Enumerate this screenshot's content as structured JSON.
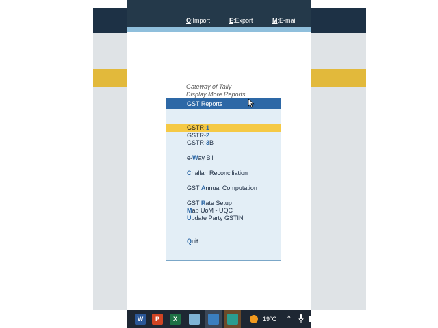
{
  "toolbar": {
    "import": {
      "key": "O",
      "label": "Import"
    },
    "export": {
      "key": "E",
      "label": "Export"
    },
    "email": {
      "key": "M",
      "label": "E-mail"
    }
  },
  "breadcrumb": {
    "line1": "Gateway of Tally",
    "line2": "Display More Reports"
  },
  "menu": {
    "title": "GST Reports",
    "items": [
      {
        "hotkey": "",
        "pre": "GSTR-",
        "key": "1",
        "post": "",
        "active": true
      },
      {
        "hotkey": "",
        "pre": "GSTR-",
        "key": "2",
        "post": "",
        "active": false
      },
      {
        "hotkey": "",
        "pre": "GSTR-",
        "key": "3",
        "post": "B",
        "active": false
      },
      {
        "hotkey": "",
        "pre": "e-",
        "key": "W",
        "post": "ay Bill",
        "active": false
      },
      {
        "hotkey": "",
        "pre": "",
        "key": "C",
        "post": "hallan Reconciliation",
        "active": false
      },
      {
        "hotkey": "",
        "pre": "GST ",
        "key": "A",
        "post": "nnual Computation",
        "active": false
      },
      {
        "hotkey": "",
        "pre": "GST ",
        "key": "R",
        "post": "ate Setup",
        "active": false
      },
      {
        "hotkey": "",
        "pre": "",
        "key": "M",
        "post": "ap UoM - UQC",
        "active": false
      },
      {
        "hotkey": "",
        "pre": "",
        "key": "U",
        "post": "pdate Party GSTIN",
        "active": false
      },
      {
        "hotkey": "",
        "pre": "",
        "key": "Q",
        "post": "uit",
        "active": false
      }
    ]
  },
  "taskbar": {
    "apps": [
      {
        "icon": "word-icon",
        "letter": "W",
        "color": "#2b5797"
      },
      {
        "icon": "powerpoint-icon",
        "letter": "P",
        "color": "#d04423"
      },
      {
        "icon": "excel-icon",
        "letter": "X",
        "color": "#1e7145"
      },
      {
        "icon": "notepad-icon",
        "letter": "",
        "color": "#7fb3d5"
      },
      {
        "icon": "tally-icon",
        "letter": "",
        "color": "#3a7ebf"
      },
      {
        "icon": "filmora-icon",
        "letter": "",
        "color": "#2a9d8f"
      }
    ],
    "temperature": "19°C"
  },
  "colors": {
    "accent": "#2d68a6",
    "highlight": "#f5c945",
    "panel": "#e3eef6",
    "topbar": "#24394a"
  }
}
